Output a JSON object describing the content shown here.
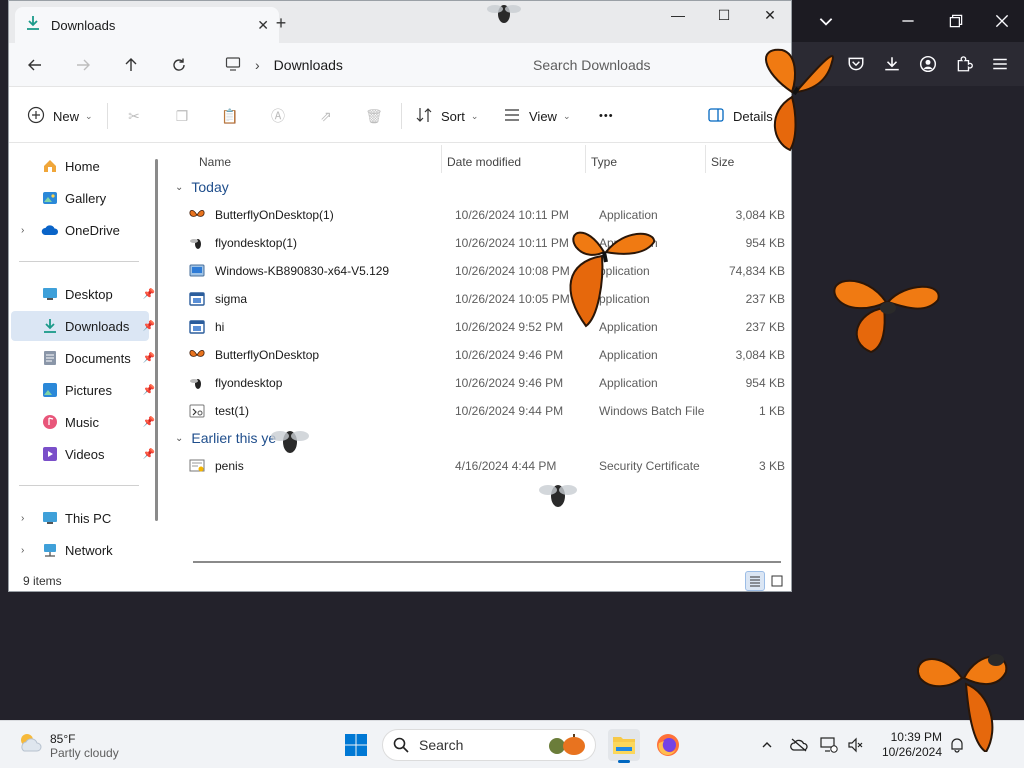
{
  "explorer": {
    "tab_title": "Downloads",
    "address": "Downloads",
    "search_placeholder": "Search Downloads",
    "toolbar": {
      "new_label": "New",
      "sort_label": "Sort",
      "view_label": "View",
      "more_label": "•••",
      "details_label": "Details"
    },
    "sidebar": {
      "items": [
        {
          "label": "Home",
          "icon": "home-icon"
        },
        {
          "label": "Gallery",
          "icon": "gallery-icon"
        },
        {
          "label": "OneDrive",
          "icon": "cloud-icon"
        },
        {
          "label": "Desktop",
          "icon": "desktop-icon"
        },
        {
          "label": "Downloads",
          "icon": "download-icon"
        },
        {
          "label": "Documents",
          "icon": "documents-icon"
        },
        {
          "label": "Pictures",
          "icon": "pictures-icon"
        },
        {
          "label": "Music",
          "icon": "music-icon"
        },
        {
          "label": "Videos",
          "icon": "videos-icon"
        },
        {
          "label": "This PC",
          "icon": "pc-icon"
        },
        {
          "label": "Network",
          "icon": "network-icon"
        }
      ]
    },
    "columns": {
      "name": "Name",
      "date": "Date modified",
      "type": "Type",
      "size": "Size"
    },
    "groups": {
      "today": "Today",
      "earlier": "Earlier this ye"
    },
    "files": [
      {
        "name": "ButterflyOnDesktop(1)",
        "date": "10/26/2024 10:11 PM",
        "type": "Application",
        "size": "3,084 KB",
        "icon": "butterfly-app-icon"
      },
      {
        "name": "flyondesktop(1)",
        "date": "10/26/2024 10:11 PM",
        "type": "Application",
        "size": "954 KB",
        "icon": "fly-app-icon"
      },
      {
        "name": "Windows-KB890830-x64-V5.129",
        "date": "10/26/2024 10:08 PM",
        "type": "pplication",
        "size": "74,834 KB",
        "icon": "installer-icon"
      },
      {
        "name": "sigma",
        "date": "10/26/2024 10:05 PM",
        "type": "pplication",
        "size": "237 KB",
        "icon": "window-app-icon"
      },
      {
        "name": "hi",
        "date": "10/26/2024 9:52 PM",
        "type": "Application",
        "size": "237 KB",
        "icon": "window-app-icon"
      },
      {
        "name": "ButterflyOnDesktop",
        "date": "10/26/2024 9:46 PM",
        "type": "Application",
        "size": "3,084 KB",
        "icon": "butterfly-app-icon"
      },
      {
        "name": "flyondesktop",
        "date": "10/26/2024 9:46 PM",
        "type": "Application",
        "size": "954 KB",
        "icon": "fly-app-icon"
      },
      {
        "name": "test(1)",
        "date": "10/26/2024 9:44 PM",
        "type": "Windows Batch File",
        "size": "1 KB",
        "icon": "batch-file-icon"
      }
    ],
    "earlier_files": [
      {
        "name": "penis",
        "date": "4/16/2024 4:44 PM",
        "type": "Security Certificate",
        "size": "3 KB",
        "icon": "certificate-icon"
      }
    ],
    "status": "9 items"
  },
  "taskbar": {
    "weather_temp": "85°F",
    "weather_cond": "Partly cloudy",
    "search_label": "Search",
    "time": "10:39 PM",
    "date": "10/26/2024"
  },
  "colors": {
    "accent": "#0067c0",
    "selected": "#dbe6f4",
    "browser_bg": "#23222b",
    "butterfly": "#f07a12"
  }
}
